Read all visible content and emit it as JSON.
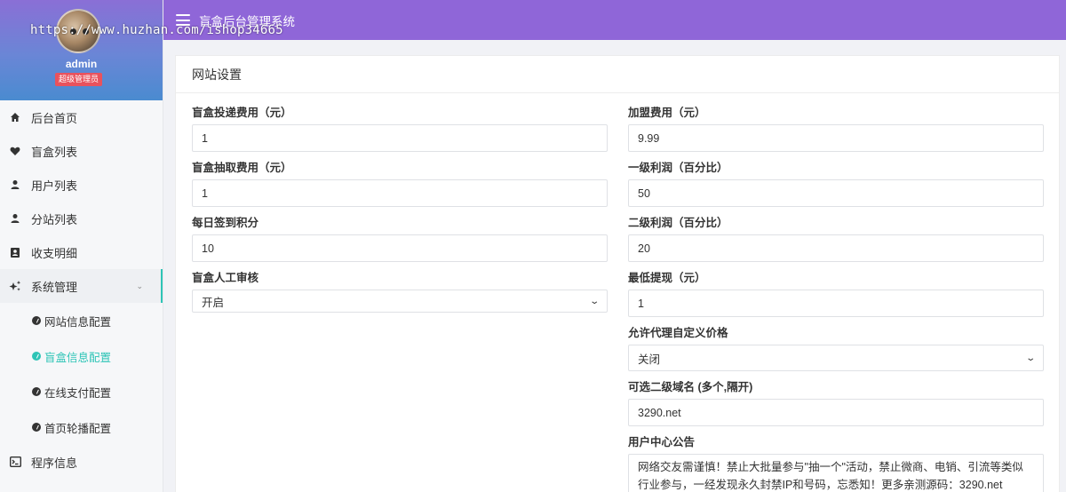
{
  "watermark": "https://www.huzhan.com/ishop34665",
  "profile": {
    "username": "admin",
    "role": "超级管理员"
  },
  "header": {
    "title": "盲盒后台管理系统"
  },
  "sidebar": {
    "items": [
      {
        "label": "后台首页",
        "icon": "home-icon"
      },
      {
        "label": "盲盒列表",
        "icon": "heart-icon"
      },
      {
        "label": "用户列表",
        "icon": "user-icon"
      },
      {
        "label": "分站列表",
        "icon": "user-icon"
      },
      {
        "label": "收支明细",
        "icon": "contacts-icon"
      },
      {
        "label": "系统管理",
        "icon": "sparkle-icon"
      },
      {
        "label": "程序信息",
        "icon": "terminal-icon"
      }
    ],
    "sub_items": [
      {
        "label": "网站信息配置"
      },
      {
        "label": "盲盒信息配置"
      },
      {
        "label": "在线支付配置"
      },
      {
        "label": "首页轮播配置"
      }
    ]
  },
  "card": {
    "title": "网站设置"
  },
  "form": {
    "blindbox_delivery_fee": {
      "label": "盲盒投递费用（元）",
      "value": "1"
    },
    "blindbox_draw_fee": {
      "label": "盲盒抽取费用（元）",
      "value": "1"
    },
    "daily_checkin_points": {
      "label": "每日签到积分",
      "value": "10"
    },
    "manual_review": {
      "label": "盲盒人工审核",
      "value": "开启"
    },
    "franchise_fee": {
      "label": "加盟费用（元）",
      "value": "9.99"
    },
    "level1_profit": {
      "label": "一级利润（百分比）",
      "value": "50"
    },
    "level2_profit": {
      "label": "二级利润（百分比）",
      "value": "20"
    },
    "min_withdraw": {
      "label": "最低提现（元）",
      "value": "1"
    },
    "agent_custom_price": {
      "label": "允许代理自定义价格",
      "value": "关闭"
    },
    "subdomains": {
      "label": "可选二级域名 (多个,隔开)",
      "value": "3290.net"
    },
    "user_notice": {
      "label": "用户中心公告",
      "value": "网络交友需谨慎！禁止大批量参与\"抽一个\"活动，禁止微商、电销、引流等类似行业参与，一经发现永久封禁IP和号码，忘悉知！更多亲测源码：3290.net"
    }
  }
}
